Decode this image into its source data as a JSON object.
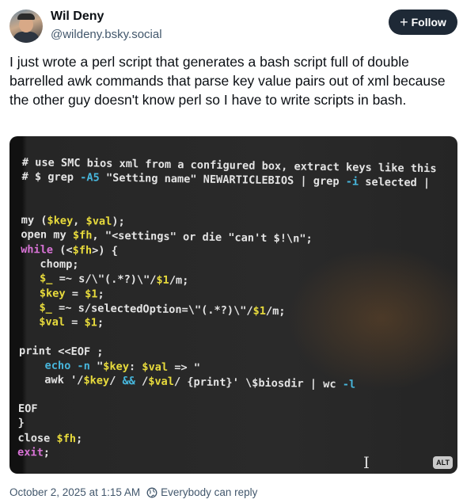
{
  "author": {
    "name": "Wil Deny",
    "handle": "@wildeny.bsky.social"
  },
  "follow_label": "Follow",
  "post_text": "I just wrote a perl script that generates a bash script full of double barrelled awk commands that parse key value pairs out of xml because the other guy doesn't know perl so I have to write scripts in bash.",
  "image": {
    "alt_badge": "ALT",
    "cursor_glyph": "I",
    "code_lines": [
      [
        [
          "# use SMC bios xml from a configured box, extract keys like this",
          "w"
        ]
      ],
      [
        [
          "# $ grep ",
          "w"
        ],
        [
          "-A5",
          "c"
        ],
        [
          " \"Setting name\" NEWARTICLEBIOS | grep ",
          "w"
        ],
        [
          "-i",
          "c"
        ],
        [
          " selected |",
          "w"
        ]
      ],
      [],
      [],
      [
        [
          "my (",
          "w"
        ],
        [
          "$key",
          "y"
        ],
        [
          ", ",
          "w"
        ],
        [
          "$val",
          "y"
        ],
        [
          ");",
          "w"
        ]
      ],
      [
        [
          "open my ",
          "w"
        ],
        [
          "$fh",
          "y"
        ],
        [
          ", \"<settings\" or die \"can't $!\\n\";",
          "w"
        ]
      ],
      [
        [
          "while",
          "m"
        ],
        [
          " (<",
          "w"
        ],
        [
          "$fh",
          "y"
        ],
        [
          ">) {",
          "w"
        ]
      ],
      [
        [
          "   chomp;",
          "w"
        ]
      ],
      [
        [
          "   ",
          "w"
        ],
        [
          "$_",
          "y"
        ],
        [
          " =~ s/\\\"(.*?)\\\"/",
          "w"
        ],
        [
          "$1",
          "y"
        ],
        [
          "/m;",
          "w"
        ]
      ],
      [
        [
          "   ",
          "w"
        ],
        [
          "$key",
          "y"
        ],
        [
          " = ",
          "w"
        ],
        [
          "$1",
          "y"
        ],
        [
          ";",
          "w"
        ]
      ],
      [
        [
          "   ",
          "w"
        ],
        [
          "$_",
          "y"
        ],
        [
          " =~ s/selectedOption=\\\"(.*?)\\\"/",
          "w"
        ],
        [
          "$1",
          "y"
        ],
        [
          "/m;",
          "w"
        ]
      ],
      [
        [
          "   ",
          "w"
        ],
        [
          "$val",
          "y"
        ],
        [
          " = ",
          "w"
        ],
        [
          "$1",
          "y"
        ],
        [
          ";",
          "w"
        ]
      ],
      [],
      [
        [
          "print <<EOF ;",
          "w"
        ]
      ],
      [
        [
          "    ",
          "w"
        ],
        [
          "echo -n",
          "c"
        ],
        [
          " \"",
          "w"
        ],
        [
          "$key",
          "y"
        ],
        [
          ": ",
          "w"
        ],
        [
          "$val",
          "y"
        ],
        [
          " => \"",
          "w"
        ]
      ],
      [
        [
          "    awk '/",
          "w"
        ],
        [
          "$key",
          "y"
        ],
        [
          "/ ",
          "w"
        ],
        [
          "&&",
          "c"
        ],
        [
          " /",
          "w"
        ],
        [
          "$val",
          "y"
        ],
        [
          "/ {print}' \\$biosdir | wc ",
          "w"
        ],
        [
          "-l",
          "c"
        ]
      ],
      [],
      [
        [
          "EOF",
          "w"
        ]
      ],
      [
        [
          "}",
          "w"
        ]
      ],
      [
        [
          "close ",
          "w"
        ],
        [
          "$fh",
          "y"
        ],
        [
          ";",
          "w"
        ]
      ],
      [
        [
          "exit",
          "m"
        ],
        [
          ";",
          "w"
        ]
      ],
      [],
      [
        [
          "~",
          "c"
        ]
      ],
      [
        [
          "~",
          "c"
        ]
      ]
    ]
  },
  "footer": {
    "timestamp": "October 2, 2025 at 1:15 AM",
    "reply_setting": "Everybody can reply"
  },
  "colors": {
    "follow_bg": "#1e2936",
    "muted": "#42576c",
    "code_yellow": "#e8db3c",
    "code_cyan": "#47b6dc",
    "code_magenta": "#d873d6"
  }
}
